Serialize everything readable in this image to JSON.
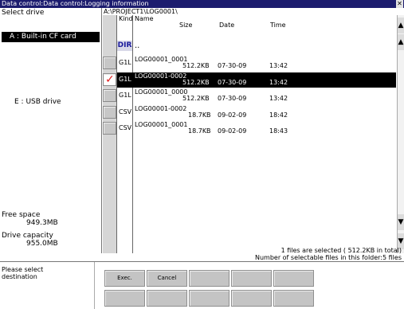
{
  "window": {
    "title": "Data control:Data control:Logging information",
    "close_glyph": "✕"
  },
  "left": {
    "select_drive_label": "Select drive",
    "drives": [
      {
        "label": "A : Built-in CF card",
        "selected": true
      },
      {
        "label": "E : USB drive",
        "selected": false
      }
    ],
    "free_space_label": "Free space",
    "free_space_value": "949.3MB",
    "drive_capacity_label": "Drive capacity",
    "drive_capacity_value": "955.0MB"
  },
  "path": "A:\\PROJECT1\\LOG0001\\",
  "file_list": {
    "header_kind": "Kind",
    "header_name": "Name",
    "header_size": "Size",
    "header_date": "Date",
    "header_time": "Time",
    "dir_kind": "DIR",
    "dir_name": "..",
    "rows": [
      {
        "kind": "G1L",
        "name": "LOG00001_0001",
        "size": "512.2KB",
        "date": "07-30-09",
        "time": "13:42",
        "checked": false
      },
      {
        "kind": "G1L",
        "name": "LOG00001-0002",
        "size": "512.2KB",
        "date": "07-30-09",
        "time": "13:42",
        "checked": true
      },
      {
        "kind": "G1L",
        "name": "LOG00001_0000",
        "size": "512.2KB",
        "date": "07-30-09",
        "time": "13:42",
        "checked": false
      },
      {
        "kind": "CSV",
        "name": "LOG00001-0002",
        "size": "18.7KB",
        "date": "09-02-09",
        "time": "18:42",
        "checked": false
      },
      {
        "kind": "CSV",
        "name": "LOG00001_0001",
        "size": "18.7KB",
        "date": "09-02-09",
        "time": "18:43",
        "checked": false
      }
    ],
    "check_mark": "✓"
  },
  "status": {
    "selected_line": "1 files are selected ( 512.2KB in total)",
    "selectable_line": "Number of selectable files in this folder:5 files"
  },
  "guide": "Please select\ndestination",
  "buttons": {
    "exec": "Exec.",
    "cancel": "Cancel"
  },
  "scroll": {
    "up": "▲",
    "down": "▼"
  },
  "colors": {
    "title_bar": "#1c1c6e",
    "selected_row": "#000000",
    "check_mark": "#e21c1c",
    "dir_text": "#1a1a9c"
  }
}
